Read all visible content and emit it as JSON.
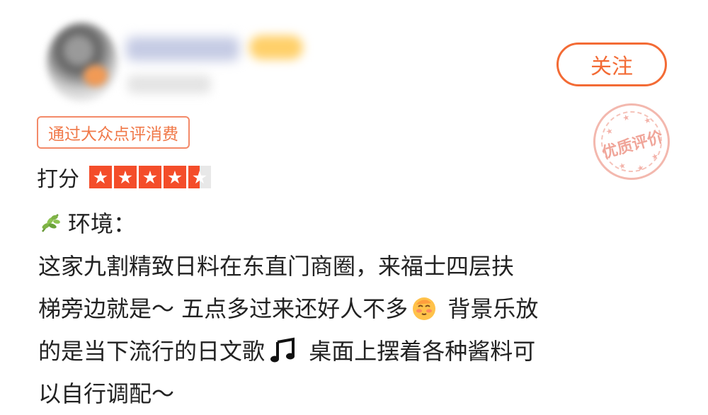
{
  "follow_button": {
    "label": "关注"
  },
  "source_tag": {
    "label": "通过大众点评消费"
  },
  "quality_stamp": {
    "label": "优质评价"
  },
  "rating": {
    "label": "打分",
    "stars": 4.5,
    "max": 5,
    "star_color": "#f44d2a"
  },
  "section": {
    "title": "环境：",
    "icon": "leaf-icon"
  },
  "review": {
    "lines": {
      "l1": "这家九割精致日料在东直门商圈，来福士四层扶",
      "l2a": "梯旁边就是～ 五点多过来还好人不多",
      "l2b": " 背景乐放",
      "l3a": "的是当下流行的日文歌",
      "l3b": " 桌面上摆着各种酱料可",
      "l4": "以自行调配～"
    },
    "emojis": [
      "peach-face-emoji",
      "music-note-emoji"
    ]
  },
  "colors": {
    "accent": "#f36b35",
    "tag_border": "#f38a69",
    "text": "#222222"
  }
}
